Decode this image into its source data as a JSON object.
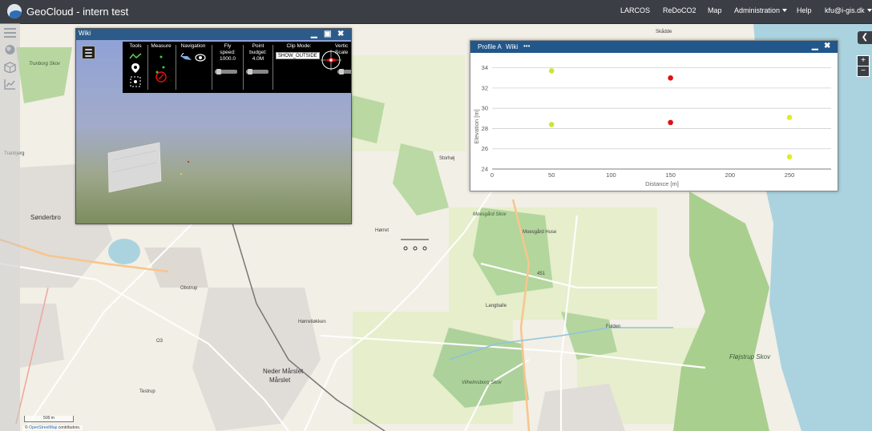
{
  "navbar": {
    "title": "GeoCloud - intern test",
    "items": [
      {
        "label": "LARCOS"
      },
      {
        "label": "ReDoCO2"
      },
      {
        "label": "Map"
      },
      {
        "label": "Administration",
        "dropdown": true
      },
      {
        "label": "Help"
      },
      {
        "label": "kfu@i-gis.dk",
        "dropdown": true
      }
    ]
  },
  "sidebar": {
    "icons": [
      "layers-icon",
      "globe-icon",
      "cube-icon",
      "chart-line-icon"
    ]
  },
  "map": {
    "labels": {
      "sonderbro": "Sønderbro",
      "trunborg": "Trunborg Skov",
      "marslet": "Mårslet",
      "neder_marslet": "Neder Mårslet",
      "horretloekken": "Hørretløkken",
      "horret": "Hørret",
      "langballe": "Langballe",
      "flojstrup": "Fløjstrup Skov",
      "moesgaard_huse": "Moesgård Huse",
      "moesgaard_skov": "Moesgård Skov",
      "vilhelmsborg": "Vilhelmsborg Skov",
      "storhoj": "Storhøj",
      "obstrup": "Obstrup",
      "tranbjerg": "Tranbjerg",
      "fulden": "Fulden",
      "skodde": "Skådde",
      "road_451": "451",
      "road_o3": "O3",
      "testrup": "Testrup"
    },
    "scale_label": "500 m",
    "attribution_prefix": "©",
    "attribution_link": "OpenStreetMap",
    "attribution_suffix": "contributors."
  },
  "wiki_window": {
    "title": "Wiki",
    "toolbar": {
      "tools_label": "Tools",
      "measure_label": "Measure",
      "navigation_label": "Navigation",
      "fly_speed_label": "Fly speed:",
      "fly_speed_value": "1000.0",
      "point_budget_label": "Point budget:",
      "point_budget_value": "4.0M",
      "clip_mode_label": "Clip Mode:",
      "clip_mode_value": "SHOW_OUTSIDE",
      "vertical_label": "Vertic",
      "scale_label": "Scale"
    }
  },
  "profile_window": {
    "tab_label": "Profile A",
    "wiki_label": "Wiki",
    "more_label": "•••"
  },
  "chart_data": {
    "type": "scatter",
    "xlabel": "Distance [m]",
    "ylabel": "Elevation [m]",
    "xlim": [
      0,
      285
    ],
    "ylim": [
      24,
      35
    ],
    "xticks": [
      0,
      50,
      100,
      150,
      200,
      250
    ],
    "yticks": [
      24,
      26,
      28,
      30,
      32,
      34
    ],
    "grid": true,
    "points": [
      {
        "x": 50,
        "y": 33.7,
        "color": "#c8e63a"
      },
      {
        "x": 50,
        "y": 28.4,
        "color": "#c8e63a"
      },
      {
        "x": 150,
        "y": 33.0,
        "color": "#e01010"
      },
      {
        "x": 150,
        "y": 28.6,
        "color": "#e01010"
      },
      {
        "x": 250,
        "y": 29.1,
        "color": "#e0ee20"
      },
      {
        "x": 250,
        "y": 25.2,
        "color": "#e0ee20"
      }
    ]
  },
  "controls": {
    "collapse_label": "❮",
    "zoom_in_label": "+",
    "zoom_out_label": "−"
  }
}
